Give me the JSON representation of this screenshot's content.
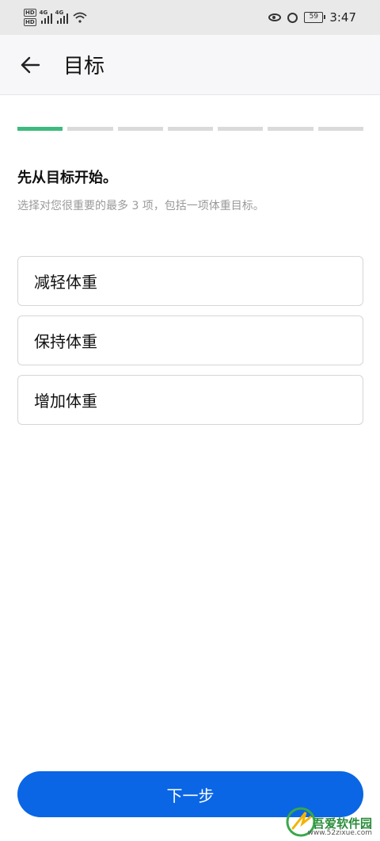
{
  "status_bar": {
    "network_left": "4G",
    "network_right": "4G",
    "battery": "59",
    "time": "3:47",
    "icons": [
      "hd-icon",
      "signal-icon",
      "wifi-icon",
      "eye-icon",
      "alarm-icon",
      "battery-icon"
    ]
  },
  "app_bar": {
    "title": "目标",
    "back_icon": "arrow-left-icon"
  },
  "progress": {
    "total_steps": 7,
    "current_step": 1,
    "active_color": "#3dbb7f",
    "inactive_color": "#dadada"
  },
  "intro": {
    "heading": "先从目标开始。",
    "subheading": "选择对您很重要的最多 3 项，包括一项体重目标。"
  },
  "options": [
    {
      "label": "减轻体重"
    },
    {
      "label": "保持体重"
    },
    {
      "label": "增加体重"
    }
  ],
  "footer": {
    "next_label": "下一步",
    "button_color": "#0a66e4"
  },
  "watermark": {
    "name": "吾爱软件园",
    "url": "www.52zixue.com"
  }
}
